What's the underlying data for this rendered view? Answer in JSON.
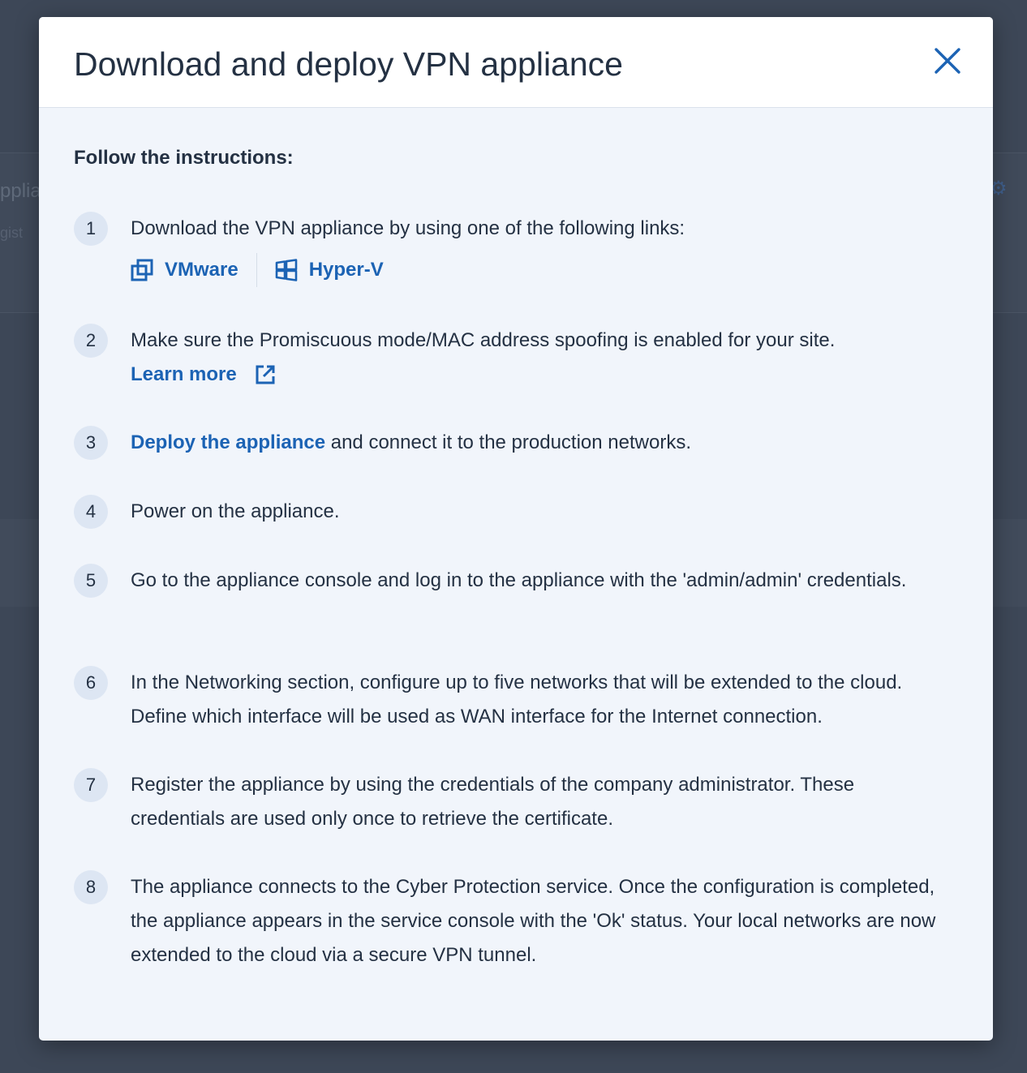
{
  "background": {
    "partial_title": "pplia",
    "partial_subtitle": "gist"
  },
  "modal": {
    "title": "Download and deploy VPN appliance",
    "close_icon": "close-icon",
    "intro": "Follow the instructions:",
    "steps": [
      {
        "number": "1",
        "text": "Download the VPN appliance by using one of the following links:",
        "links": [
          {
            "label": "VMware",
            "icon": "vmware-icon"
          },
          {
            "label": "Hyper-V",
            "icon": "windows-icon"
          }
        ]
      },
      {
        "number": "2",
        "text": "Make sure the Promiscuous mode/MAC address spoofing is enabled for your site.",
        "link_label": "Learn more",
        "link_icon": "external-link-icon"
      },
      {
        "number": "3",
        "link_label": "Deploy the appliance",
        "text_after": " and connect it to the production networks."
      },
      {
        "number": "4",
        "text": "Power on the appliance."
      },
      {
        "number": "5",
        "text": "Go to the appliance console and log in to the appliance with the 'admin/admin' credentials."
      },
      {
        "number": "6",
        "text": "In the Networking section, configure up to five networks that will be extended to the cloud. Define which interface will be used as WAN interface for the Internet connection."
      },
      {
        "number": "7",
        "text": "Register the appliance by using the credentials of the company administrator. These credentials are used only once to retrieve the certificate."
      },
      {
        "number": "8",
        "text": "The appliance connects to the Cyber Protection service. Once the configuration is completed, the appliance appears in the service console with the 'Ok' status. Your local networks are now extended to the cloud via a secure VPN tunnel."
      }
    ]
  },
  "colors": {
    "accent": "#1c63b4",
    "text": "#243143",
    "overlay": "#3a4454",
    "modal_body": "#f1f5fb"
  }
}
